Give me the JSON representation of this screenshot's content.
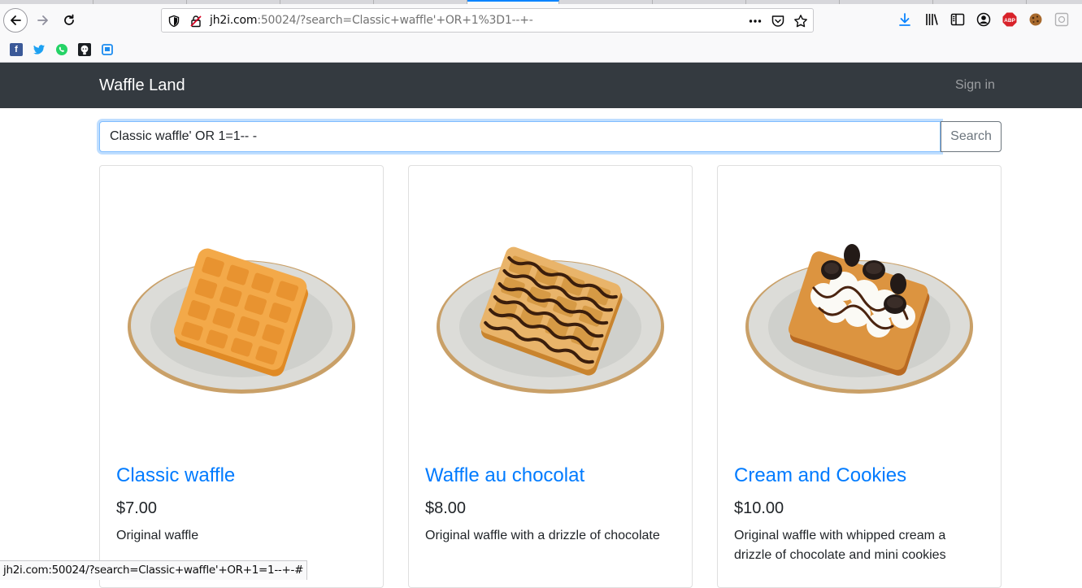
{
  "browser": {
    "url_host": "jh2i.com",
    "url_rest": ":50024/?search=Classic+waffle'+OR+1%3D1--+-",
    "status_url": "jh2i.com:50024/?search=Classic+waffle'+OR+1=1--+-#"
  },
  "navbar": {
    "brand": "Waffle Land",
    "signin_label": "Sign in"
  },
  "search": {
    "value": "Classic waffle' OR 1=1-- -",
    "button_label": "Search"
  },
  "products": [
    {
      "name": "Classic waffle",
      "price": "$7.00",
      "description": "Original waffle",
      "topping": "plain"
    },
    {
      "name": "Waffle au chocolat",
      "price": "$8.00",
      "description": "Original waffle with a drizzle of chocolate",
      "topping": "chocolate"
    },
    {
      "name": "Cream and Cookies",
      "price": "$10.00",
      "description": "Original waffle with whipped cream a drizzle of chocolate and mini cookies",
      "topping": "cookies"
    }
  ],
  "colors": {
    "navbar": "#343a40",
    "link": "#007bff",
    "waffle": "#f0a640"
  }
}
